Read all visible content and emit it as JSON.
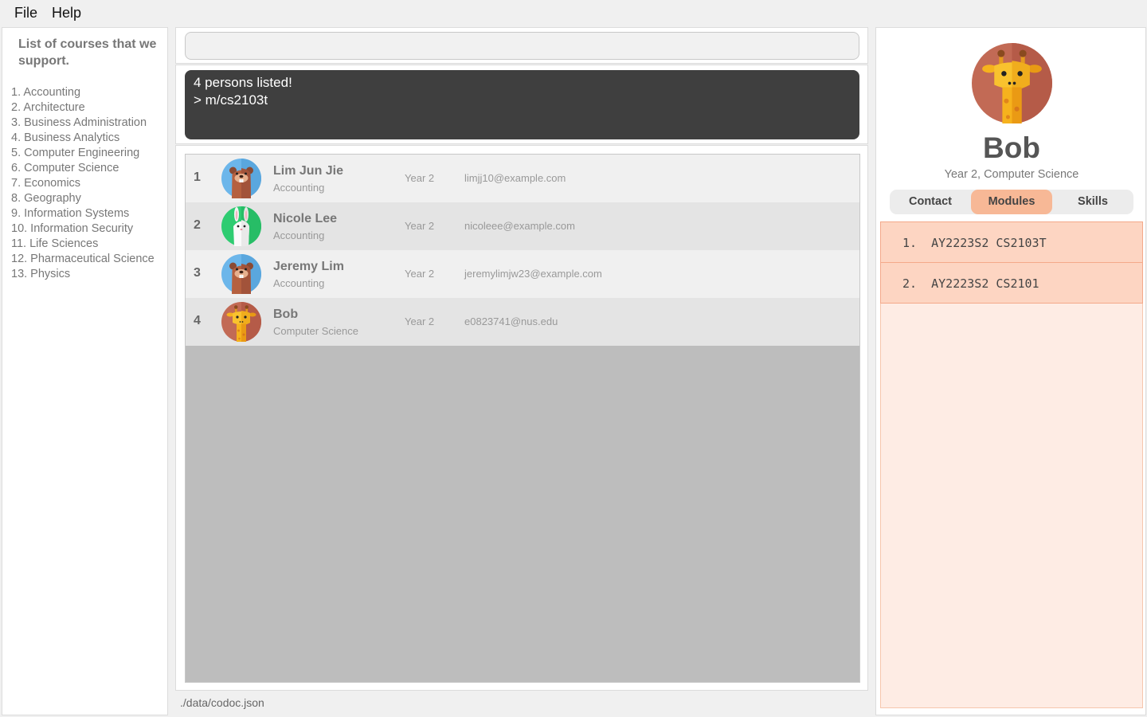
{
  "menu": {
    "file": "File",
    "help": "Help"
  },
  "courses": {
    "title": "List of courses that we support.",
    "items": [
      "1. Accounting",
      "2. Architecture",
      "3. Business Administration",
      "4. Business Analytics",
      "5. Computer Engineering",
      "6. Computer Science",
      "7. Economics",
      "8. Geography",
      "9. Information Systems",
      "10. Information Security",
      "11. Life Sciences",
      "12. Pharmaceutical Science",
      "13. Physics"
    ]
  },
  "command": {
    "value": "",
    "placeholder": ""
  },
  "result": {
    "line1": "4 persons listed!",
    "line2": "> m/cs2103t"
  },
  "persons": [
    {
      "index": "1",
      "name": "Lim Jun Jie",
      "course": "Accounting",
      "year": "Year 2",
      "email": "limjj10@example.com",
      "avatar": "beaver-icon"
    },
    {
      "index": "2",
      "name": "Nicole Lee",
      "course": "Accounting",
      "year": "Year 2",
      "email": "nicoleee@example.com",
      "avatar": "rabbit-icon"
    },
    {
      "index": "3",
      "name": "Jeremy Lim",
      "course": "Accounting",
      "year": "Year 2",
      "email": "jeremylimjw23@example.com",
      "avatar": "beaver-icon"
    },
    {
      "index": "4",
      "name": "Bob",
      "course": "Computer Science",
      "year": "Year 2",
      "email": "e0823741@nus.edu",
      "avatar": "giraffe-icon"
    }
  ],
  "status": {
    "path": "./data/codoc.json"
  },
  "profile": {
    "name": "Bob",
    "subtitle": "Year 2, Computer Science",
    "avatar": "giraffe-icon",
    "tabs": {
      "contact": "Contact",
      "modules": "Modules",
      "skills": "Skills"
    },
    "active_tab": "Modules",
    "modules": [
      {
        "index": "1.",
        "year": "AY2223S2",
        "code": "CS2103T"
      },
      {
        "index": "2.",
        "year": "AY2223S2",
        "code": "CS2101"
      }
    ]
  },
  "colors": {
    "result_bg": "#3f3f3f",
    "tab_active": "#f7b896",
    "module_row": "#fdd5c2",
    "module_area": "#feece4"
  }
}
